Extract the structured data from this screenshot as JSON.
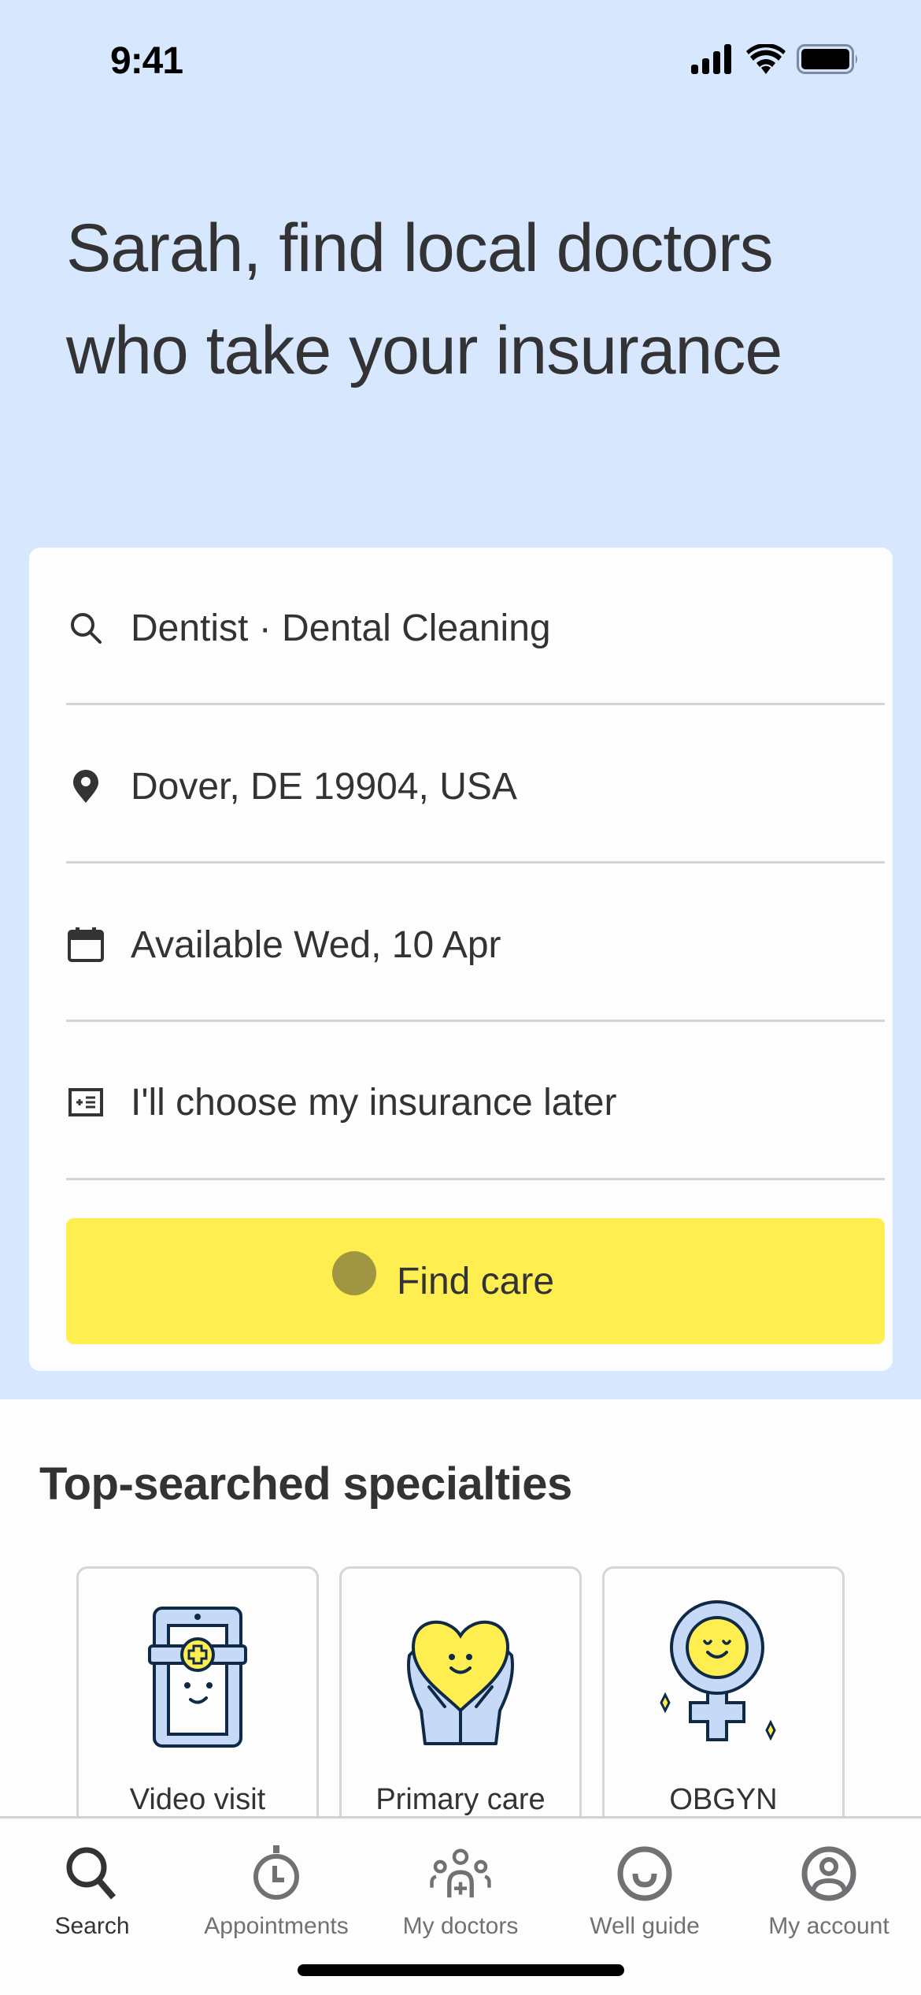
{
  "status_bar": {
    "time": "9:41"
  },
  "hero": {
    "headline": "Sarah, find local doctors who take your insurance"
  },
  "search_form": {
    "specialty_field": {
      "value": "Dentist · Dental Cleaning",
      "icon": "search-icon"
    },
    "location_field": {
      "value": "Dover, DE 19904, USA",
      "icon": "location-pin-icon"
    },
    "date_field": {
      "value": "Available Wed, 10 Apr",
      "icon": "calendar-icon"
    },
    "insurance_field": {
      "value": "I'll choose my insurance later",
      "icon": "insurance-card-icon"
    },
    "submit_label": "Find care"
  },
  "specialties": {
    "title": "Top-searched specialties",
    "items": [
      {
        "label": "Video visit",
        "icon": "video-visit-tablet-icon"
      },
      {
        "label": "Primary care",
        "icon": "heart-in-hands-icon"
      },
      {
        "label": "OBGYN",
        "icon": "female-symbol-icon"
      }
    ]
  },
  "bottom_nav": {
    "items": [
      {
        "label": "Search",
        "icon": "search-icon",
        "active": true
      },
      {
        "label": "Appointments",
        "icon": "stopwatch-icon",
        "active": false
      },
      {
        "label": "My doctors",
        "icon": "doctors-group-icon",
        "active": false
      },
      {
        "label": "Well guide",
        "icon": "smile-icon",
        "active": false
      },
      {
        "label": "My account",
        "icon": "account-icon",
        "active": false
      }
    ]
  },
  "colors": {
    "hero_background": "#d7e8fe",
    "primary_button": "#ffee50",
    "text_primary": "#333336",
    "text_secondary": "#717175",
    "illustration_blue": "#c6d9f7",
    "illustration_yellow": "#ffee50",
    "illustration_outline": "#0e2a47"
  }
}
